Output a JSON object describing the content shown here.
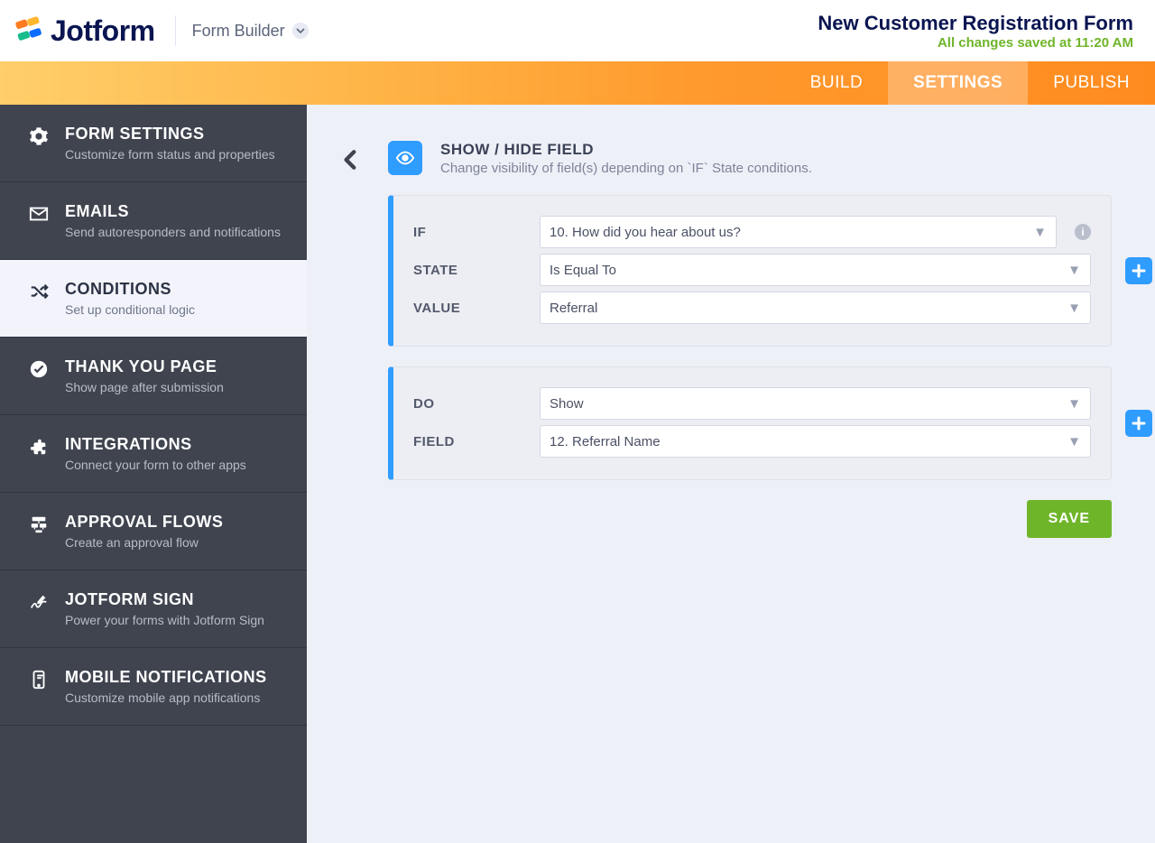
{
  "header": {
    "brand_word": "Jotform",
    "crumb_label": "Form Builder",
    "form_title": "New Customer Registration Form",
    "save_status": "All changes saved at 11:20 AM"
  },
  "tabs": {
    "build": "BUILD",
    "settings": "SETTINGS",
    "publish": "PUBLISH",
    "active": "settings"
  },
  "sidebar": {
    "items": [
      {
        "title": "FORM SETTINGS",
        "sub": "Customize form status and properties"
      },
      {
        "title": "EMAILS",
        "sub": "Send autoresponders and notifications"
      },
      {
        "title": "CONDITIONS",
        "sub": "Set up conditional logic"
      },
      {
        "title": "THANK YOU PAGE",
        "sub": "Show page after submission"
      },
      {
        "title": "INTEGRATIONS",
        "sub": "Connect your form to other apps"
      },
      {
        "title": "APPROVAL FLOWS",
        "sub": "Create an approval flow"
      },
      {
        "title": "JOTFORM SIGN",
        "sub": "Power your forms with Jotform Sign"
      },
      {
        "title": "MOBILE NOTIFICATIONS",
        "sub": "Customize mobile app notifications"
      }
    ],
    "active_index": 2
  },
  "condition": {
    "header_title": "SHOW / HIDE FIELD",
    "header_sub": "Change visibility of field(s) depending on `IF` State conditions.",
    "if_section": {
      "labels": {
        "if": "IF",
        "state": "STATE",
        "value": "VALUE"
      },
      "if_value": "10. How did you hear about us?",
      "state_value": "Is Equal To",
      "value_value": "Referral"
    },
    "do_section": {
      "labels": {
        "do": "DO",
        "field": "FIELD"
      },
      "do_value": "Show",
      "field_value": "12. Referral Name"
    },
    "save_label": "SAVE"
  }
}
